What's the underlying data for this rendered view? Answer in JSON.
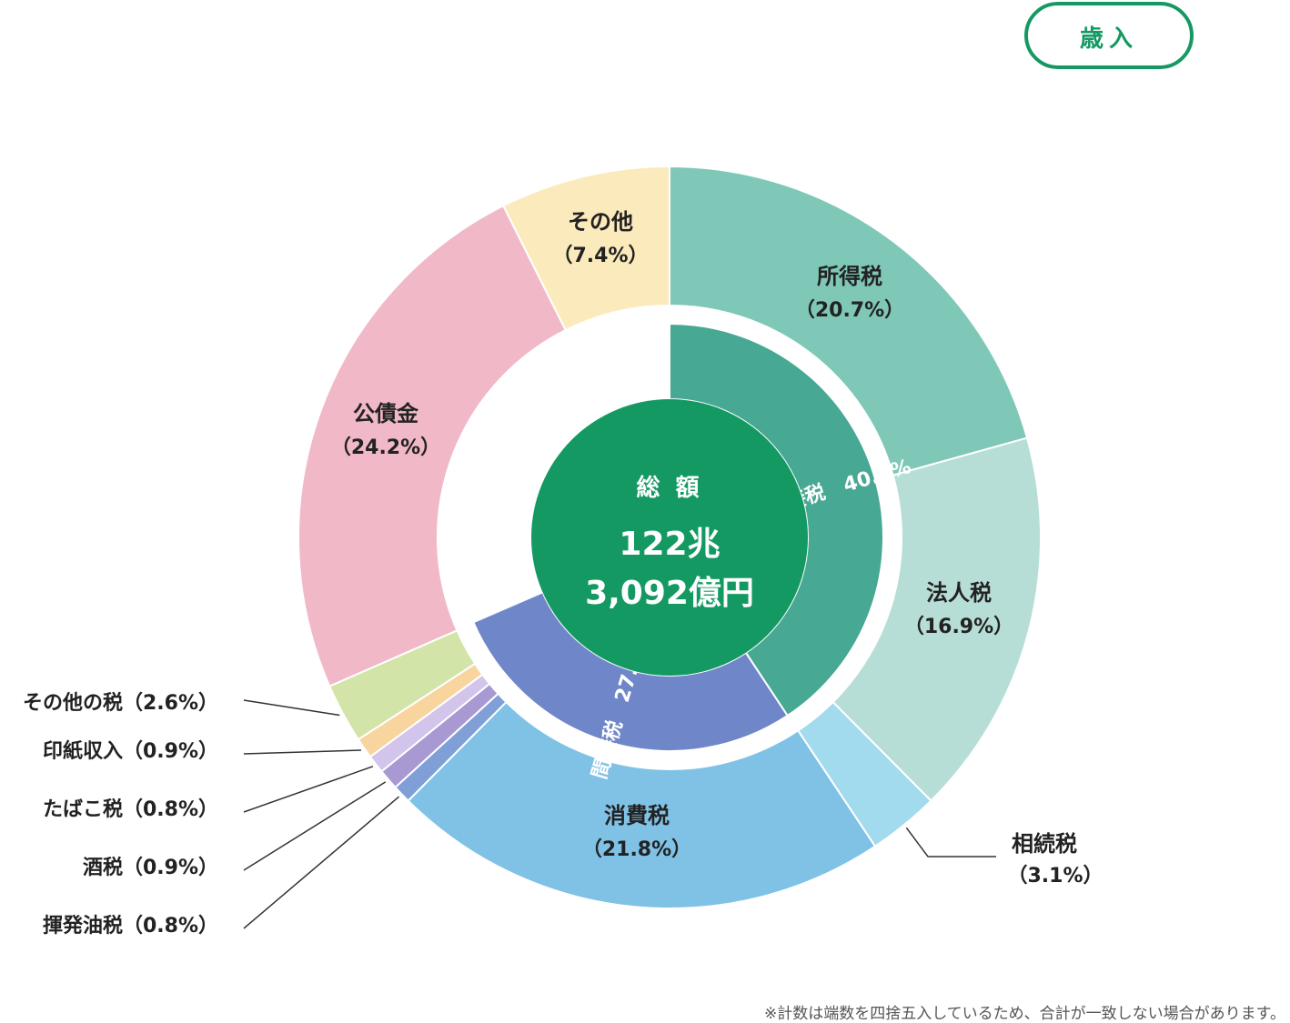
{
  "badge": "歳入",
  "center": {
    "label": "総 額",
    "line1": "122兆",
    "line2": "3,092億円"
  },
  "note": "※計数は端数を四捨五入しているため、合計が一致しない場合があります。",
  "chart_data": {
    "type": "pie",
    "outer": [
      {
        "name": "所得税",
        "pct_label": "（20.7%）",
        "value": 20.7,
        "color": "#7fc8b8"
      },
      {
        "name": "法人税",
        "pct_label": "（16.9%）",
        "value": 16.9,
        "color": "#b7ded6"
      },
      {
        "name": "相続税",
        "pct_label": "（3.1%）",
        "value": 3.1,
        "color": "#a3dbee"
      },
      {
        "name": "消費税",
        "pct_label": "（21.8%）",
        "value": 21.8,
        "color": "#80c2e6"
      },
      {
        "name": "揮発油税",
        "pct_label": "（0.8%）",
        "value": 0.8,
        "color": "#7f9fd6"
      },
      {
        "name": "酒税",
        "pct_label": "（0.9%）",
        "value": 0.9,
        "color": "#a899d2"
      },
      {
        "name": "たばこ税",
        "pct_label": "（0.8%）",
        "value": 0.8,
        "color": "#d3c4ec"
      },
      {
        "name": "印紙収入",
        "pct_label": "（0.9%）",
        "value": 0.9,
        "color": "#f8d59e"
      },
      {
        "name": "その他の税",
        "pct_label": "（2.6%）",
        "value": 2.6,
        "color": "#d2e4a8"
      },
      {
        "name": "公債金",
        "pct_label": "（24.2%）",
        "value": 24.2,
        "color": "#f1b9c8"
      },
      {
        "name": "その他",
        "pct_label": "（7.4%）",
        "value": 7.4,
        "color": "#fbeabb"
      }
    ],
    "inner": [
      {
        "name": "直接税",
        "value_label": "40.7%",
        "value": 40.7,
        "color": "#47a893"
      },
      {
        "name": "間接税",
        "value_label": "27.8%",
        "value": 27.8,
        "color": "#6f86c8"
      }
    ]
  }
}
